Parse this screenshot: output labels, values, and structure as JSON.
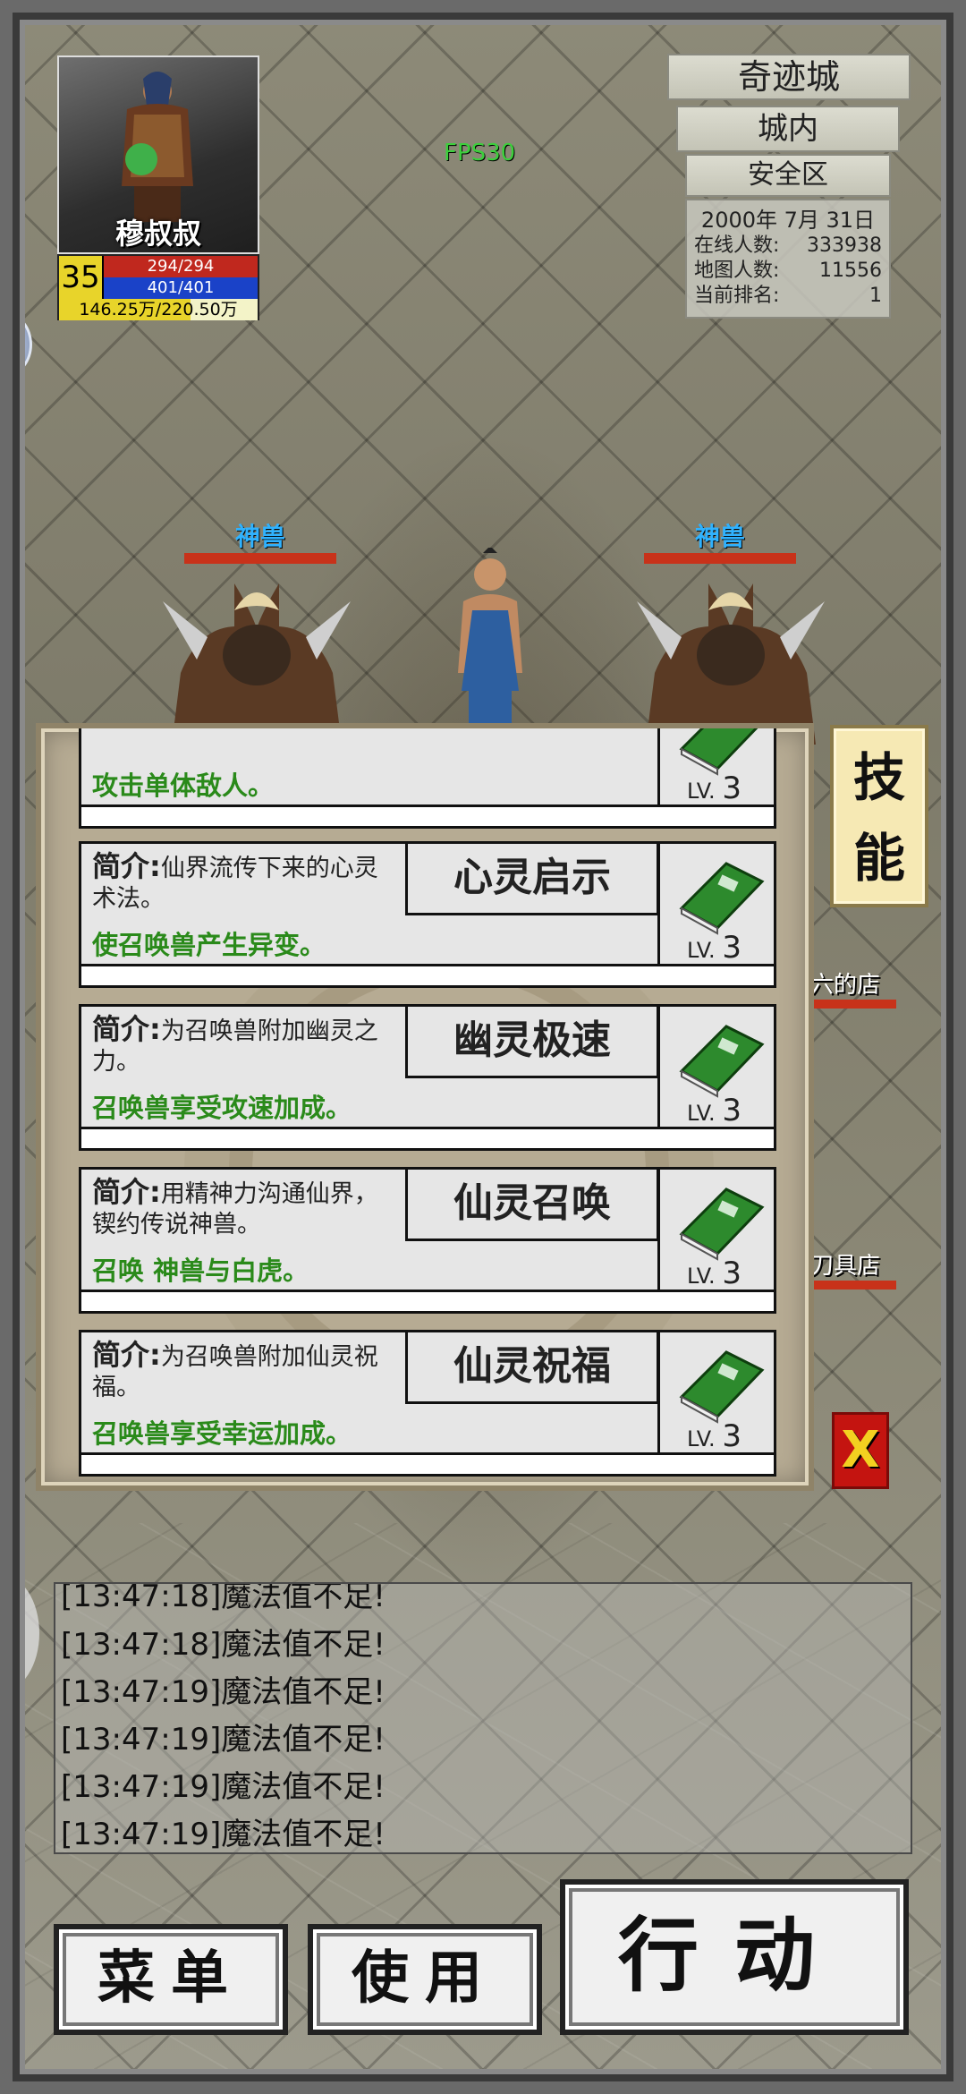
{
  "player": {
    "name": "穆叔叔",
    "level": "35",
    "hp": "294/294",
    "mp": "401/401",
    "exp": "146.25万/220.50万",
    "exp_fraction": 0.663
  },
  "location": {
    "city": "奇迹城",
    "area": "城内",
    "zone": "安全区",
    "date": "2000年 7月 31日",
    "stats": [
      {
        "label": "在线人数:",
        "value": "333938"
      },
      {
        "label": "地图人数:",
        "value": "11556"
      },
      {
        "label": "当前排名:",
        "value": "1"
      }
    ]
  },
  "fps": "FPS30",
  "npcs": {
    "left": "神兽",
    "right": "神兽",
    "shop1": "六的店",
    "shop2": "刀具店"
  },
  "skill_tab": "技能",
  "close_label": "X",
  "skills": [
    {
      "desc_label": "",
      "desc": "",
      "effect": "攻击单体敌人。",
      "name": "",
      "lv_label": "LV.",
      "lv": "3"
    },
    {
      "desc_label": "简介:",
      "desc": "仙界流传下来的心灵术法。",
      "effect": "使召唤兽产生异变。",
      "name": "心灵启示",
      "lv_label": "LV.",
      "lv": "3"
    },
    {
      "desc_label": "简介:",
      "desc": "为召唤兽附加幽灵之力。",
      "effect": "召唤兽享受攻速加成。",
      "name": "幽灵极速",
      "lv_label": "LV.",
      "lv": "3"
    },
    {
      "desc_label": "简介:",
      "desc": "用精神力沟通仙界，锲约传说神兽。",
      "effect": "召唤 神兽与白虎。",
      "name": "仙灵召唤",
      "lv_label": "LV.",
      "lv": "3"
    },
    {
      "desc_label": "简介:",
      "desc": "为召唤兽附加仙灵祝福。",
      "effect": "召唤兽享受幸运加成。",
      "name": "仙灵祝福",
      "lv_label": "LV.",
      "lv": "3"
    }
  ],
  "chat_log": [
    "[13:47:18]魔法值不足!",
    "[13:47:18]魔法值不足!",
    "[13:47:19]魔法值不足!",
    "[13:47:19]魔法值不足!",
    "[13:47:19]魔法值不足!",
    "[13:47:19]魔法值不足!"
  ],
  "buttons": {
    "menu": "菜单",
    "use": "使用",
    "act": "行动"
  }
}
